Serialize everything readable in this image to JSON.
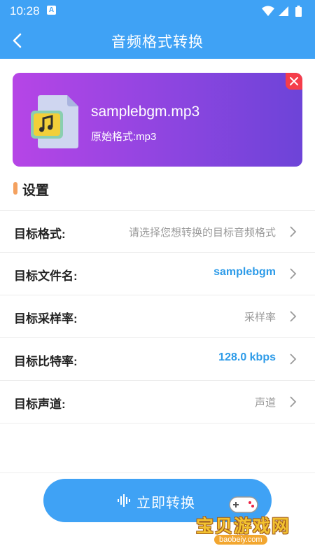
{
  "status_bar": {
    "time": "10:28",
    "notification_icon": "A"
  },
  "app_bar": {
    "title": "音频格式转换"
  },
  "file_card": {
    "filename": "samplebgm.mp3",
    "original_format": "原始格式:mp3"
  },
  "settings": {
    "heading": "设置",
    "rows": [
      {
        "label": "目标格式:",
        "value": "请选择您想转换的目标音频格式"
      },
      {
        "label": "目标文件名:",
        "value": "samplebgm"
      },
      {
        "label": "目标采样率:",
        "value": "采样率"
      },
      {
        "label": "目标比特率:",
        "value": "128.0 kbps"
      },
      {
        "label": "目标声道:",
        "value": "声道"
      }
    ]
  },
  "convert_button": {
    "label": "立即转换"
  },
  "watermark": {
    "text": "宝贝游戏网",
    "site": "baobeiy.com"
  },
  "colors": {
    "primary": "#3fa2f5",
    "card_start": "#b645e6",
    "card_end": "#6d44d8",
    "value_active": "#2d9be8",
    "accent_bar": "#f4a15f",
    "close": "#f53d4a"
  }
}
